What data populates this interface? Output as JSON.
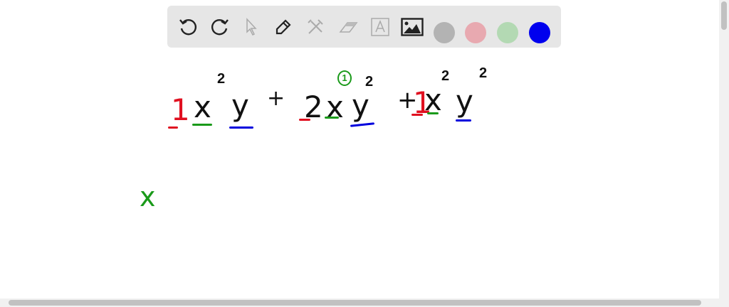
{
  "toolbar": {
    "tools": [
      "undo",
      "redo",
      "select",
      "pen",
      "tools",
      "eraser",
      "text",
      "image"
    ],
    "colors": [
      "#b3b3b3",
      "#e8a9b0",
      "#b3d9b3",
      "#0000ee"
    ]
  },
  "canvas": {
    "expression": [
      {
        "text": "1",
        "color": "#e01020"
      },
      {
        "text": "x",
        "color": "#111111"
      },
      {
        "text": "2",
        "color": "#111111"
      },
      {
        "text": "y",
        "color": "#111111"
      },
      {
        "text": "+",
        "color": "#111111"
      },
      {
        "text": "2",
        "color": "#111111"
      },
      {
        "text": "x",
        "color": "#111111"
      },
      {
        "text": "1",
        "color": "#1a9a1a"
      },
      {
        "text": "y",
        "color": "#111111"
      },
      {
        "text": "2",
        "color": "#111111"
      },
      {
        "text": "+",
        "color": "#111111"
      },
      {
        "text": "1",
        "color": "#e01020"
      },
      {
        "text": "x",
        "color": "#111111"
      },
      {
        "text": "2",
        "color": "#111111"
      },
      {
        "text": "y",
        "color": "#111111"
      },
      {
        "text": "2",
        "color": "#111111"
      }
    ],
    "note": {
      "text": "x",
      "color": "#1a9a1a"
    },
    "underline_colors": {
      "coef": "#e01020",
      "x": "#1a9a1a",
      "y": "#0000dd"
    }
  }
}
